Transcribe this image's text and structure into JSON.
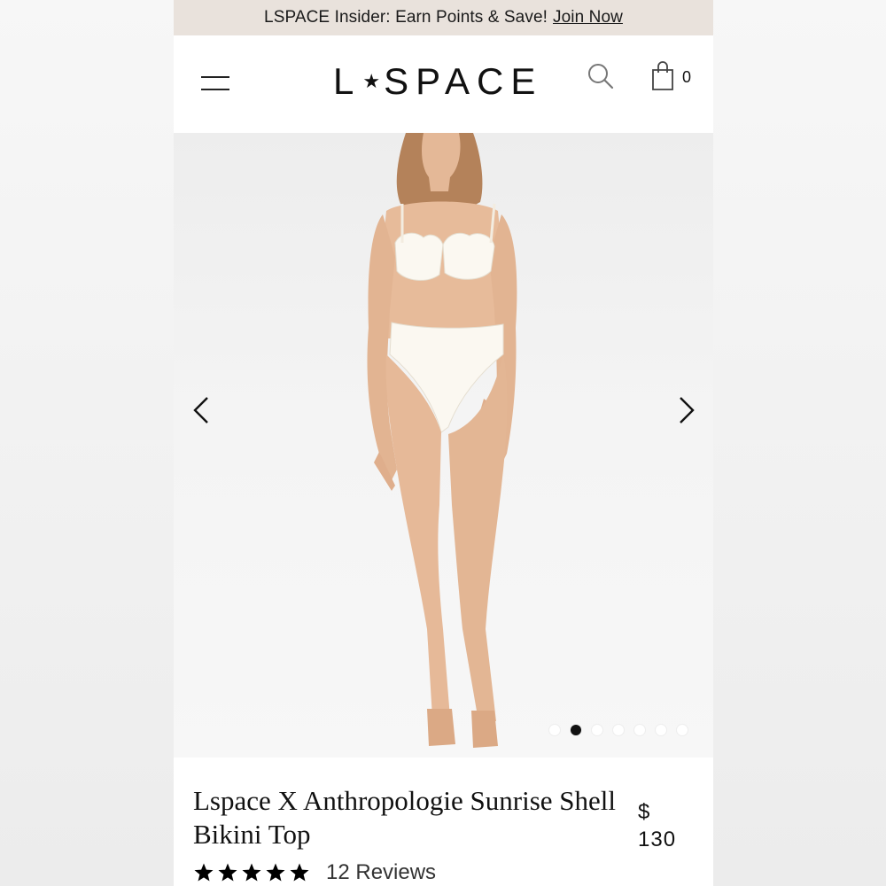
{
  "promo": {
    "text": "LSPACE Insider: Earn Points & Save!",
    "link": "Join Now"
  },
  "header": {
    "logo_left": "L",
    "logo_star": "★",
    "logo_right": "SPACE",
    "menu_icon": "hamburger-menu-icon",
    "search_icon": "search-icon",
    "bag_icon": "shopping-bag-icon",
    "cart_count": "0"
  },
  "gallery": {
    "image_count": 7,
    "active_index": 1,
    "prev_icon": "chevron-left-icon",
    "next_icon": "chevron-right-icon"
  },
  "product": {
    "title": "Lspace X Anthropologie Sunrise Shell Bikini Top",
    "price_currency": "$",
    "price_value": "130",
    "rating_stars": 5,
    "reviews_label": "12 Reviews"
  },
  "colors": {
    "promo_bg": "#e9e2dc",
    "text": "#111111",
    "active_dot": "#111111",
    "inactive_dot": "#ffffff"
  }
}
